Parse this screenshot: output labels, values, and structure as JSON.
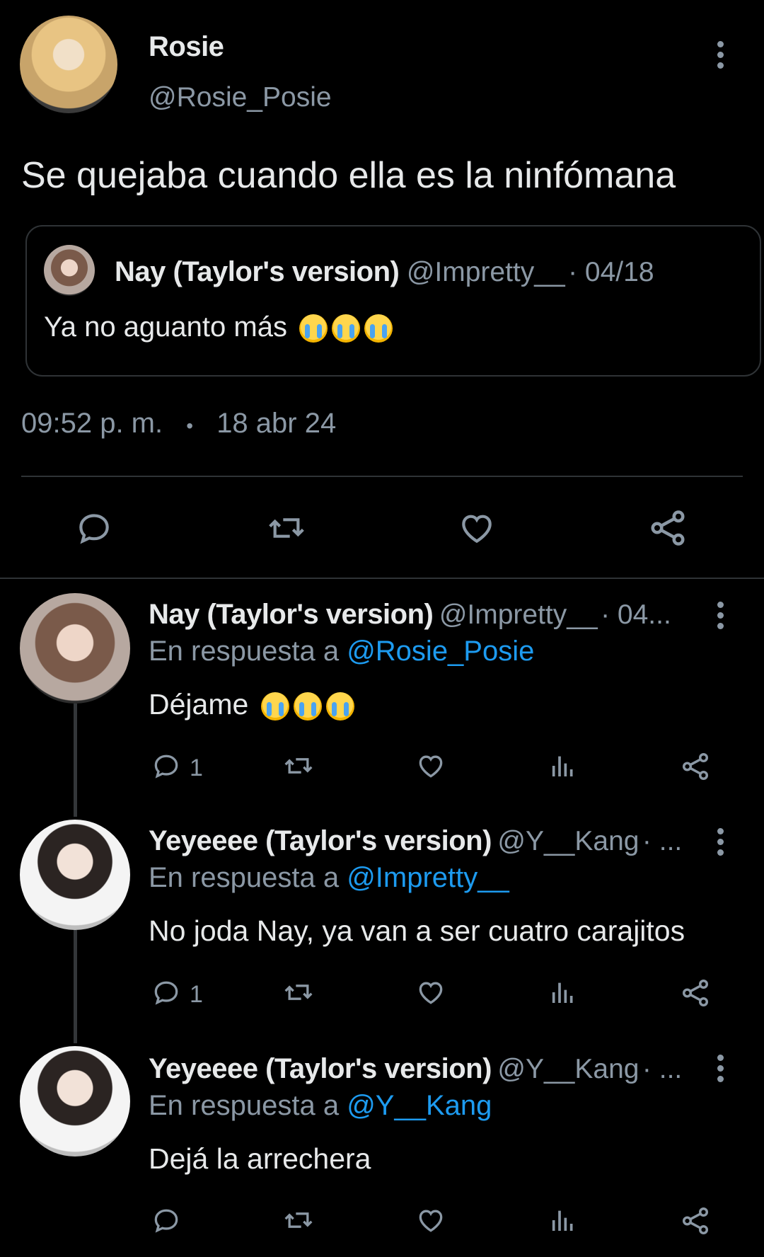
{
  "main_tweet": {
    "author_name": "Rosie",
    "author_handle": "@Rosie_Posie",
    "text": "Se quejaba cuando ella es la ninfómana",
    "quoted": {
      "author_name": "Nay (Taylor's version)",
      "author_handle": "@Impretty__",
      "date": "· 04/18",
      "text": "Ya no aguanto más"
    },
    "time": "09:52 p. m.",
    "separator": "•",
    "date": "18 abr 24"
  },
  "replies": [
    {
      "author_name": "Nay (Taylor's version)",
      "author_handle": "@Impretty__",
      "date": "· 04...",
      "reply_prefix": "En respuesta a",
      "reply_to": "@Rosie_Posie",
      "text": "Déjame",
      "reply_count": "1"
    },
    {
      "author_name": "Yeyeeee (Taylor's version)",
      "author_handle": "@Y__Kang",
      "date": "· ...",
      "reply_prefix": "En respuesta a",
      "reply_to": "@Impretty__",
      "text": "No joda Nay, ya van a ser cuatro carajitos",
      "reply_count": "1"
    },
    {
      "author_name": "Yeyeeee (Taylor's version)",
      "author_handle": "@Y__Kang",
      "date": "· ...",
      "reply_prefix": "En respuesta a",
      "reply_to": "@Y__Kang",
      "text": "Dejá la arrechera",
      "reply_count": ""
    }
  ],
  "icons": {
    "reply": "speech-bubble-icon",
    "retweet": "retweet-icon",
    "like": "heart-icon",
    "views": "bar-chart-icon",
    "share": "share-icon",
    "more": "vertical-dots-icon"
  },
  "colors": {
    "background": "#000000",
    "text": "#e7e9ea",
    "muted": "#8b98a5",
    "link": "#1d9bf0"
  }
}
